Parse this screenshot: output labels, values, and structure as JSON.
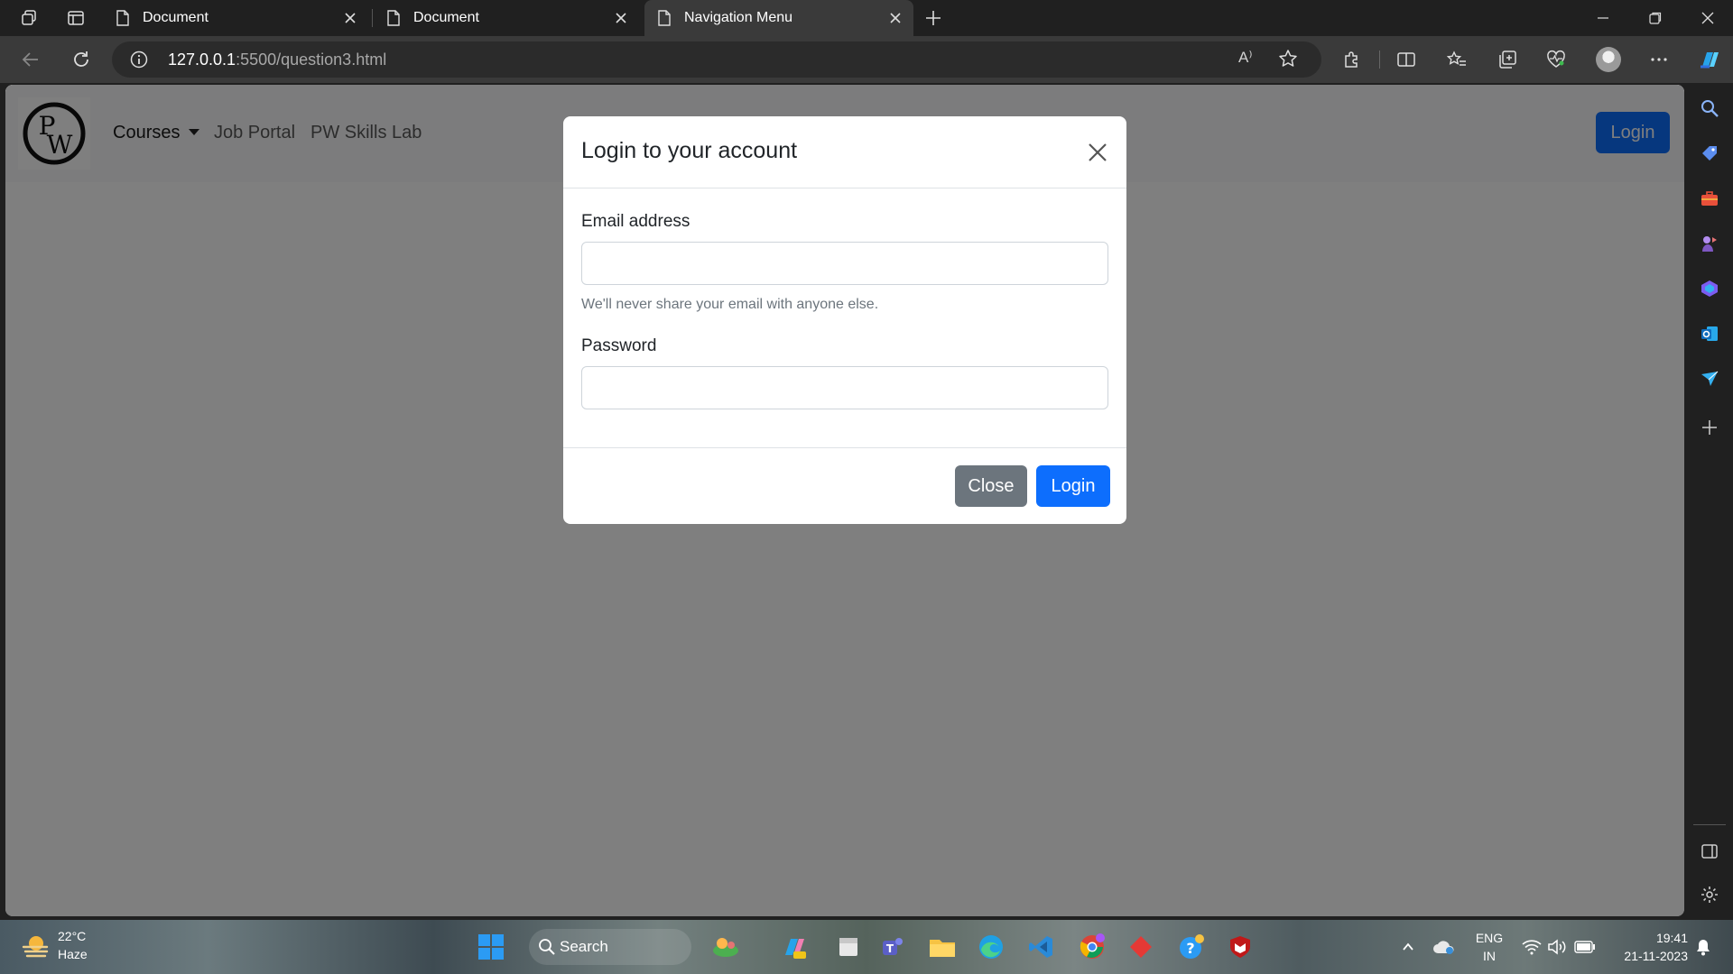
{
  "browser": {
    "tabs": [
      {
        "label": "Document",
        "active": false
      },
      {
        "label": "Document",
        "active": false
      },
      {
        "label": "Navigation Menu",
        "active": true
      }
    ],
    "new_tab_icon": "plus-icon",
    "url_host": "127.0.0.1",
    "url_rest": ":5500/question3.html",
    "read_aloud": "A⁾",
    "accent": "#0d6efd"
  },
  "page": {
    "brand_letters": {
      "top": "P",
      "bottom": "W"
    },
    "nav": {
      "courses": "Courses",
      "job_portal": "Job Portal",
      "skills_lab": "PW Skills Lab",
      "login": "Login"
    },
    "modal": {
      "title": "Login to your account",
      "email_label": "Email address",
      "email_value": "",
      "email_help": "We'll never share your email with anyone else.",
      "password_label": "Password",
      "password_value": "",
      "close_button": "Close",
      "login_button": "Login"
    }
  },
  "taskbar": {
    "temperature": "22°C",
    "weather": "Haze",
    "search": "Search",
    "lang_top": "ENG",
    "lang_bottom": "IN",
    "time": "19:41",
    "date": "21-11-2023"
  }
}
